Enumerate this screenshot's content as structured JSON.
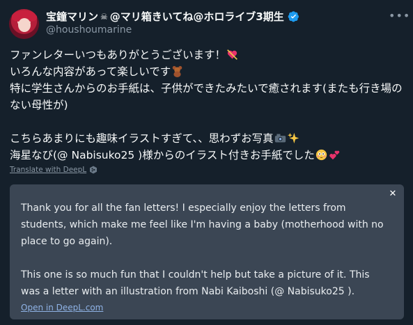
{
  "user": {
    "display_name": "宝鐘マリン🏴‍☠️@マリ箱きいてね@ホロライブ3期生",
    "display_name_text": "宝鐘マリン",
    "display_name_suffix": "@マリ箱きいてね@ホロライブ3期生",
    "handle": "@houshoumarine",
    "verified": true
  },
  "tweet": {
    "lines": [
      "ファンレターいつもありがとうございます！",
      "いろんな内容があって楽しいです",
      "特に学生さんからのお手紙は、子供ができたみたいで癒されます(またも行き場のない母性が)",
      "",
      "こちらあまりにも趣味イラストすぎて、、思わずお写真",
      "海星なび(@ Nabisuko25 )様からのイラスト付きお手紙でした"
    ]
  },
  "translate": {
    "label": "Translate with DeepL"
  },
  "translation": {
    "paragraph1": "Thank you for all the fan letters! I especially enjoy the letters from students, which make me feel like I'm having a baby (motherhood with no place to go again).",
    "paragraph2": "This one is so much fun that I couldn't help but take a picture of it. This was a letter with an illustration from Nabi Kaiboshi (@ Nabisuko25 ).",
    "open_link": "Open in DeepL.com",
    "close_symbol": "✕"
  },
  "icons": {
    "more": "more-icon",
    "verified": "verified-badge-icon",
    "close": "close-icon",
    "deepl": "deepl-icon"
  },
  "colors": {
    "background": "#15202b",
    "translation_box": "#3b4654",
    "link": "#8fb3e6",
    "verified": "#1d9bf0",
    "muted": "#8b98a5"
  }
}
